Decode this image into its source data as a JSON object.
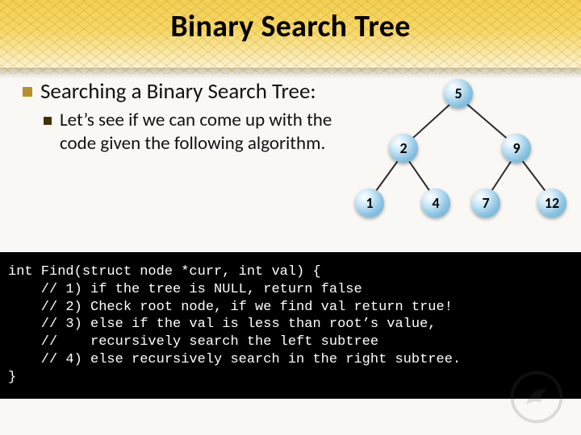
{
  "title": "Binary Search Tree",
  "heading": "Searching a Binary Search Tree:",
  "subpoint": "Let’s see if we can come up with the code given the following algorithm.",
  "tree": {
    "n5": "5",
    "n2": "2",
    "n9": "9",
    "n1": "1",
    "n4": "4",
    "n7": "7",
    "n12": "12"
  },
  "code_lines": [
    "int Find(struct node *curr, int val) {",
    "    // 1) if the tree is NULL, return false",
    "    // 2) Check root node, if we find val return true!",
    "    // 3) else if the val is less than root’s value,",
    "    //    recursively search the left subtree",
    "    // 4) else recursively search in the right subtree.",
    "}"
  ],
  "chart_data": {
    "type": "diagram",
    "structure": "binary-search-tree",
    "root": 5,
    "edges": [
      [
        5,
        2
      ],
      [
        5,
        9
      ],
      [
        2,
        1
      ],
      [
        2,
        4
      ],
      [
        9,
        7
      ],
      [
        9,
        12
      ]
    ],
    "nodes": [
      1,
      2,
      4,
      5,
      7,
      9,
      12
    ]
  }
}
